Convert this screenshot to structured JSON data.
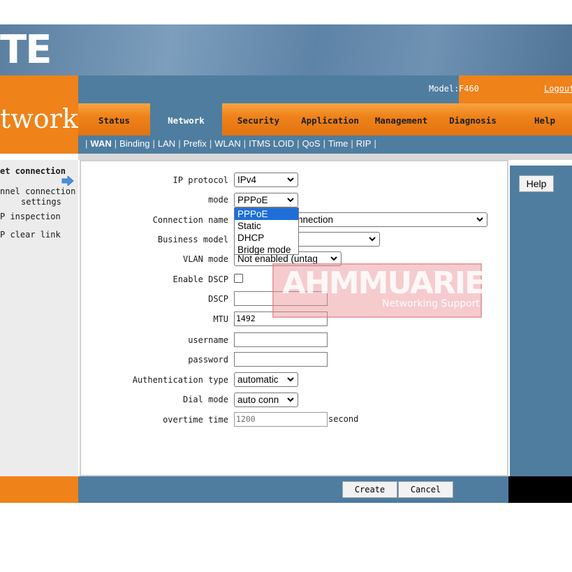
{
  "header": {
    "logo_text": "TE",
    "section_title": "twork",
    "model_label": "Model:",
    "model_value": "F460",
    "logout": "Logout"
  },
  "menu": [
    {
      "label": "Status",
      "active": false
    },
    {
      "label": "Network",
      "active": true
    },
    {
      "label": "Security",
      "active": false
    },
    {
      "label": "Application",
      "active": false
    },
    {
      "label": "Management",
      "active": false
    },
    {
      "label": "Diagnosis",
      "active": false
    },
    {
      "label": "Help",
      "active": false
    }
  ],
  "submenu": [
    "WAN",
    "Binding",
    "LAN",
    "Prefix",
    "WLAN",
    "ITMS LOID",
    "QoS",
    "Time",
    "RIP"
  ],
  "leftnav": {
    "item1": "et connection",
    "item2_line1": "nnel connection",
    "item2_line2": "settings",
    "item3": "P inspection",
    "item4": "P clear link",
    "arrow_icon": "right-arrow-icon"
  },
  "form": {
    "ip_protocol_label": "IP protocol",
    "ip_protocol_value": "IPv4",
    "mode_label": "mode",
    "mode_value": "PPPoE",
    "connection_name_label": "Connection name",
    "connection_name_value": "nnection",
    "business_model_label": "Business model",
    "business_model_value": "",
    "vlan_mode_label": "VLAN mode",
    "vlan_mode_value": "Not enabled (untag",
    "enable_dscp_label": "Enable DSCP",
    "dscp_label": "DSCP",
    "dscp_value": "",
    "mtu_label": "MTU",
    "mtu_value": "1492",
    "username_label": "username",
    "username_value": "",
    "password_label": "password",
    "password_value": "",
    "auth_type_label": "Authentication type",
    "auth_type_value": "automatic",
    "dial_mode_label": "Dial mode",
    "dial_mode_value": "auto conn",
    "overtime_label": "overtime time",
    "overtime_value": "1200",
    "overtime_unit": "second"
  },
  "mode_dropdown": {
    "options": [
      "PPPoE",
      "Static",
      "DHCP",
      "Bridge mode"
    ],
    "selected": "PPPoE"
  },
  "watermark": {
    "text": "AHMMUARIEF",
    "subtext": "Networking Support"
  },
  "help_button": "Help",
  "footer": {
    "create": "Create",
    "cancel": "Cancel"
  },
  "colors": {
    "orange": "#ef8219",
    "blue": "#4f7da0",
    "selection": "#1e6fd9"
  }
}
